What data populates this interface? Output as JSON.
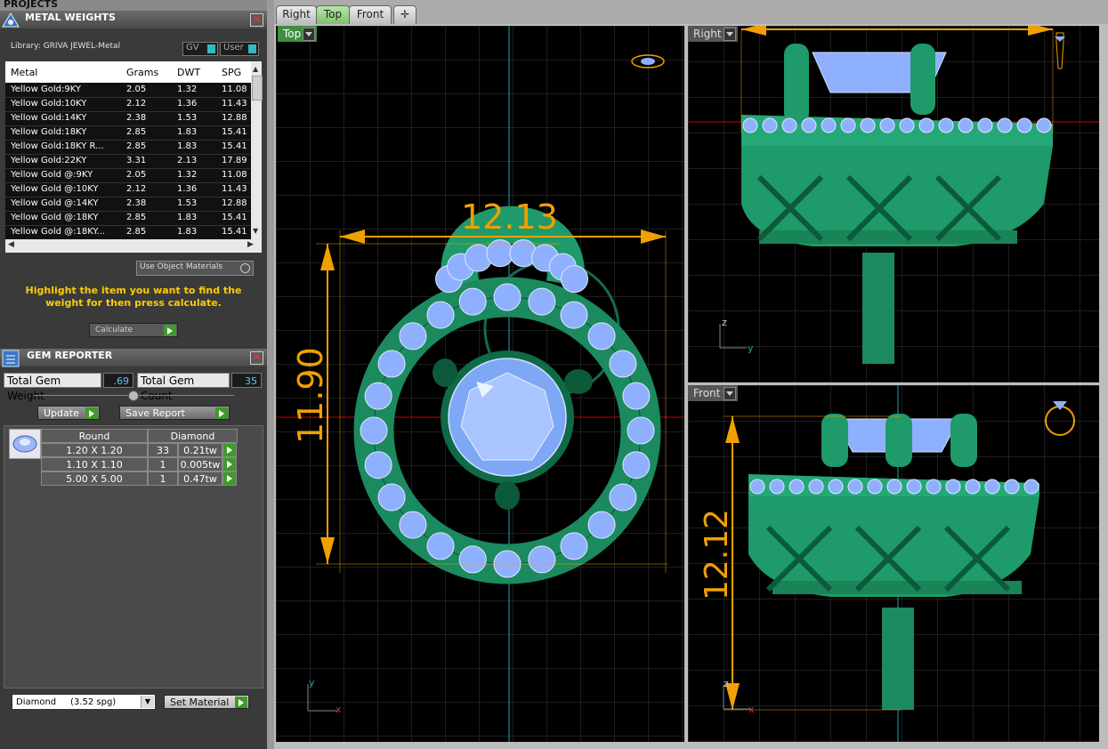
{
  "projects": {
    "title": "PROJECTS"
  },
  "metal_weights": {
    "title": "METAL WEIGHTS",
    "library_label": "Library: GRIVA JEWEL-Metal",
    "toggle_gv": "GV",
    "toggle_user": "User",
    "columns": [
      "Metal",
      "Grams",
      "DWT",
      "SPG"
    ],
    "rows": [
      {
        "metal": "Yellow Gold:9KY",
        "grams": "2.05",
        "dwt": "1.32",
        "spg": "11.08"
      },
      {
        "metal": "Yellow Gold:10KY",
        "grams": "2.12",
        "dwt": "1.36",
        "spg": "11.43"
      },
      {
        "metal": "Yellow Gold:14KY",
        "grams": "2.38",
        "dwt": "1.53",
        "spg": "12.88"
      },
      {
        "metal": "Yellow Gold:18KY",
        "grams": "2.85",
        "dwt": "1.83",
        "spg": "15.41"
      },
      {
        "metal": "Yellow Gold:18KY R...",
        "grams": "2.85",
        "dwt": "1.83",
        "spg": "15.41"
      },
      {
        "metal": "Yellow Gold:22KY",
        "grams": "3.31",
        "dwt": "2.13",
        "spg": "17.89"
      },
      {
        "metal": "Yellow Gold @:9KY",
        "grams": "2.05",
        "dwt": "1.32",
        "spg": "11.08"
      },
      {
        "metal": "Yellow Gold @:10KY",
        "grams": "2.12",
        "dwt": "1.36",
        "spg": "11.43"
      },
      {
        "metal": "Yellow Gold @:14KY",
        "grams": "2.38",
        "dwt": "1.53",
        "spg": "12.88"
      },
      {
        "metal": "Yellow Gold @:18KY",
        "grams": "2.85",
        "dwt": "1.83",
        "spg": "15.41"
      },
      {
        "metal": "Yellow Gold @:18KY...",
        "grams": "2.85",
        "dwt": "1.83",
        "spg": "15.41"
      }
    ],
    "use_object_materials": "Use Object Materials",
    "hint": "Highlight the item you want to find the weight for then press calculate.",
    "calculate": "Calculate"
  },
  "gem_reporter": {
    "title": "GEM REPORTER",
    "total_weight_label": "Total Gem Weight",
    "total_weight_value": ".69",
    "total_count_label": "Total Gem Count",
    "total_count_value": "35",
    "update": "Update",
    "save_report": "Save Report",
    "header_shape": "Round",
    "header_material": "Diamond",
    "gems": [
      {
        "size": "1.20 X 1.20",
        "count": "33",
        "weight": "0.21tw"
      },
      {
        "size": "1.10 X 1.10",
        "count": "1",
        "weight": "0.005tw"
      },
      {
        "size": "5.00 X 5.00",
        "count": "1",
        "weight": "0.47tw"
      }
    ],
    "material_select": "Diamond     (3.52 spg)",
    "set_material": "Set Material"
  },
  "view_tabs": [
    "Right",
    "Top",
    "Front"
  ],
  "viewports": {
    "top": {
      "label": "Top",
      "dim_width": "12.13",
      "dim_height": "11.90",
      "axis_y": "y",
      "axis_x": "x"
    },
    "right": {
      "label": "Right",
      "axis_z": "z",
      "axis_y": "y"
    },
    "front": {
      "label": "Front",
      "dim_height": "12.12",
      "axis_z": "z",
      "axis_x": "x"
    }
  },
  "colors": {
    "metal": "#1f9a6a",
    "gem": "#8fb0ff",
    "dimension": "#f0a000",
    "grid": "#3a3a3a"
  }
}
